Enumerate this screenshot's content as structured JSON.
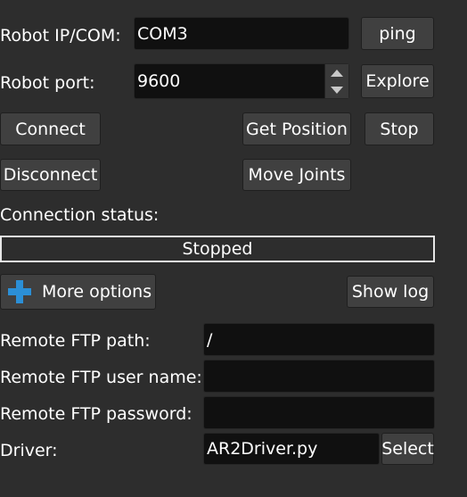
{
  "connection": {
    "ip_label": "Robot IP/COM:",
    "ip_value": "COM3",
    "port_label": "Robot port:",
    "port_value": "9600",
    "ping_label": "ping",
    "explore_label": "Explore"
  },
  "actions": {
    "connect_label": "Connect",
    "disconnect_label": "Disconnect",
    "get_position_label": "Get Position",
    "stop_label": "Stop",
    "move_joints_label": "Move Joints"
  },
  "status": {
    "label": "Connection status:",
    "value": "Stopped"
  },
  "options": {
    "more_options_label": "More options",
    "more_options_icon": "plus-icon",
    "show_log_label": "Show log"
  },
  "ftp": {
    "path_label": "Remote FTP path:",
    "path_value": "/",
    "user_label": "Remote FTP user name:",
    "user_value": "",
    "password_label": "Remote FTP password:",
    "password_value": ""
  },
  "driver": {
    "label": "Driver:",
    "value": "AR2Driver.py",
    "select_label": "Select"
  },
  "colors": {
    "background": "#2d2d2d",
    "field_bg": "#101010",
    "button_bg": "#404040",
    "plus_icon": "#2b8fd6"
  }
}
